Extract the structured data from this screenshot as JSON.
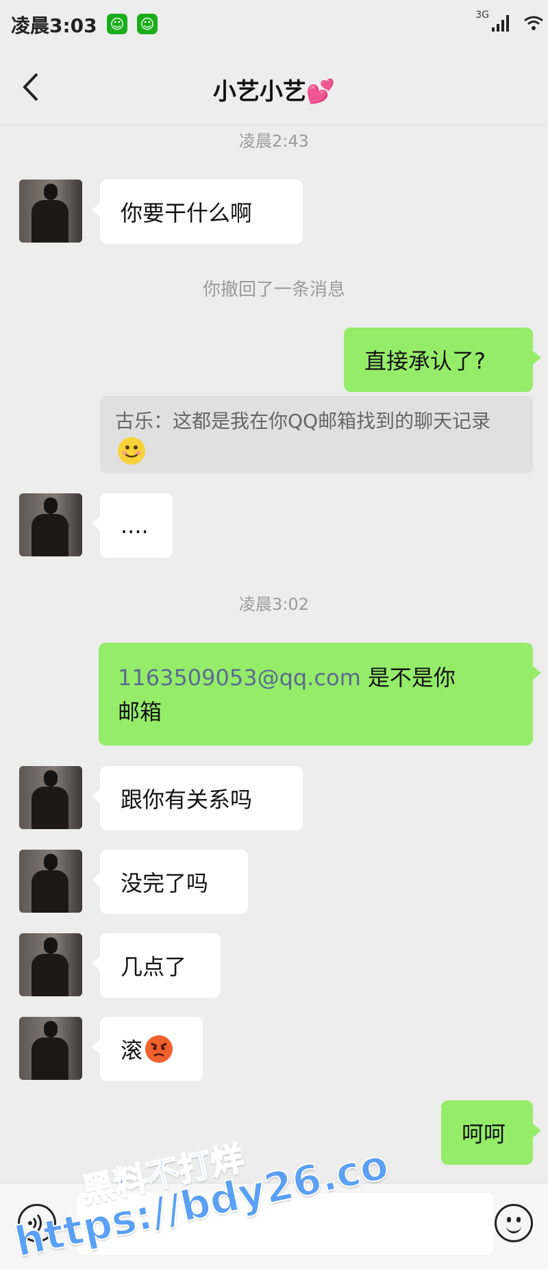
{
  "status": {
    "time": "凌晨3:03",
    "network": "3G"
  },
  "header": {
    "title": "小艺小艺",
    "title_emoji": "💕"
  },
  "messages": {
    "ts1": "凌晨2:43",
    "m1": "你要干什么啊",
    "recall": "你撤回了一条消息",
    "m2": "直接承认了?",
    "quote": "古乐：这都是我在你QQ邮箱找到的聊天记录",
    "m3": "....",
    "ts2": "凌晨3:02",
    "m4_email": "1163509053@qq.com",
    "m4_text": " 是不是你",
    "m4_line2": "邮箱",
    "m5": "跟你有关系吗",
    "m6": "没完了吗",
    "m7": "几点了",
    "m8": "滚",
    "m9": "呵呵"
  },
  "watermark": {
    "line1": "黑料不打烊",
    "line2": "https://bdy26.co"
  },
  "colors": {
    "self_bubble": "#95ec69",
    "other_bubble": "#ffffff",
    "link": "#5b6a92",
    "background": "#ededed"
  }
}
